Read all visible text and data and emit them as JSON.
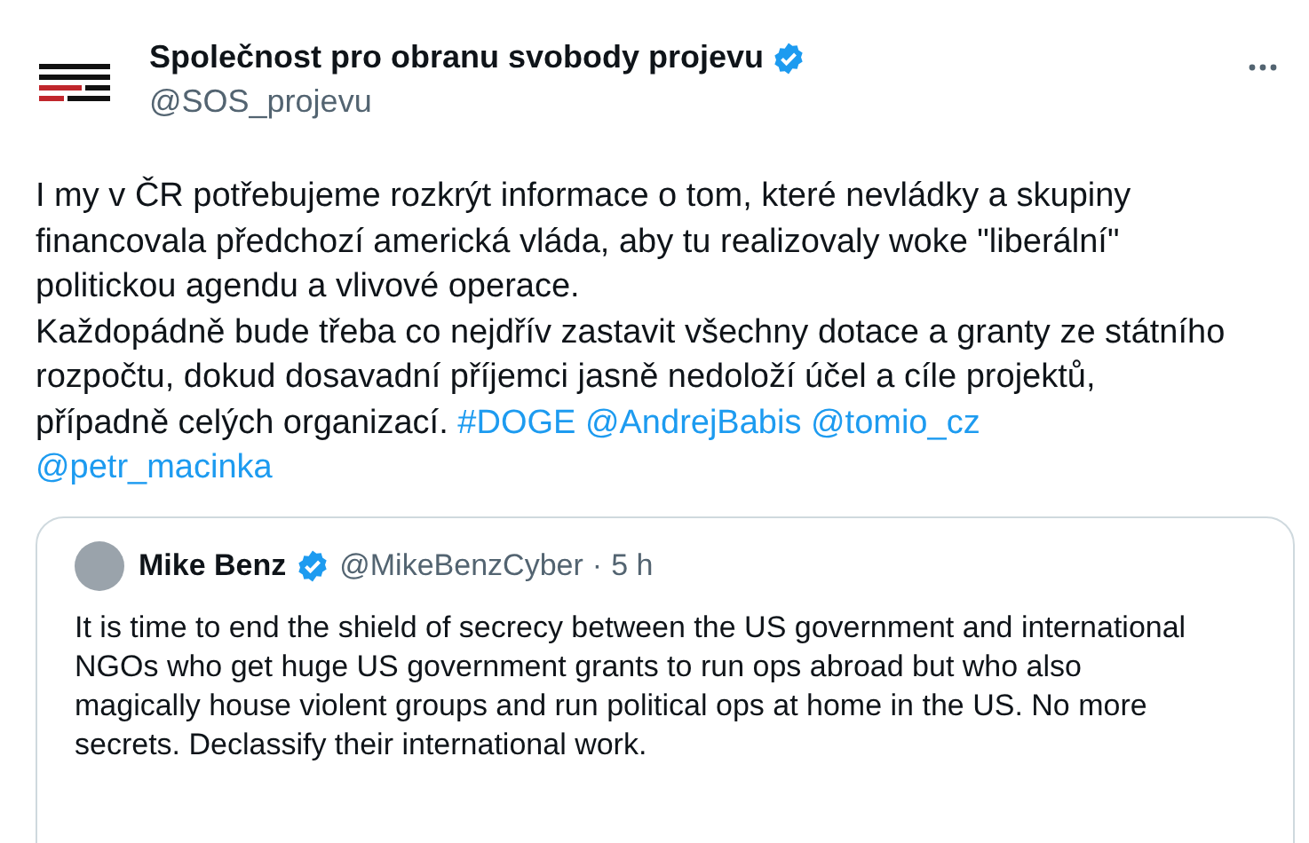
{
  "author": {
    "name": "Společnost pro obranu svobody projevu",
    "verified": true,
    "handle": "@SOS_projevu"
  },
  "paragraphs": [
    [
      {
        "kind": "text",
        "text": "I my v ČR potřebujeme rozkrýt informace o tom, které nevládky a skupiny financovala předchozí americká vláda, aby tu realizovaly woke \"liberální\" politickou agendu a vlivové operace."
      }
    ],
    [
      {
        "kind": "text",
        "text": "Každopádně bude třeba co nejdřív zastavit všechny dotace a granty ze státního rozpočtu, dokud dosavadní příjemci jasně nedoloží účel a cíle projektů, případně celých organizací."
      },
      {
        "kind": "link",
        "text": "#DOGE"
      },
      {
        "kind": "link",
        "text": "@AndrejBabis"
      },
      {
        "kind": "link",
        "text": "@tomio_cz"
      },
      {
        "kind": "link",
        "text": "@petr_macinka"
      }
    ]
  ],
  "quote": {
    "name": "Mike Benz",
    "verified": true,
    "handle": "@MikeBenzCyber",
    "separator": "·",
    "time": "5 h",
    "text": "It is time to end the shield of secrecy between the US government and international NGOs who get huge US government grants to run ops abroad but who also magically house violent groups and run political ops at home in the US. No more secrets. Declassify their international work."
  }
}
